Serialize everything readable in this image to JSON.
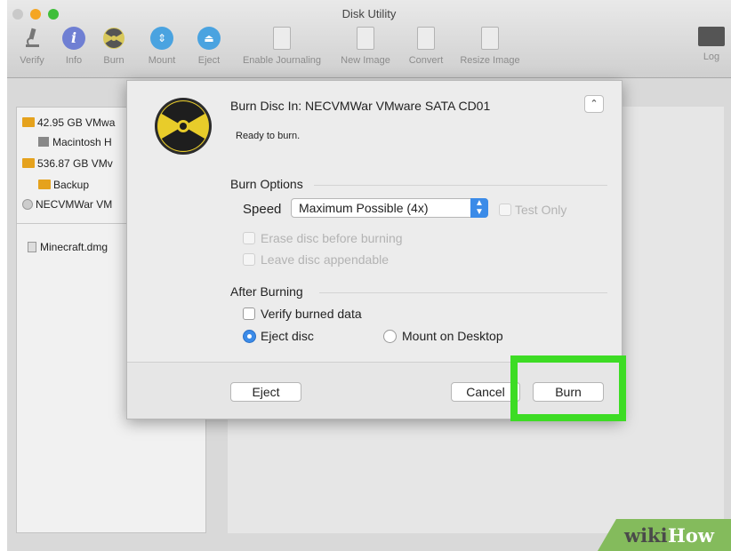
{
  "window": {
    "title": "Disk Utility"
  },
  "colors": {
    "highlight": "#3ddc24",
    "accent": "#3b8be8",
    "disk": "#e5a21d",
    "wikihow_green": "#84bb5c"
  },
  "toolbar": {
    "items": [
      {
        "label": "Verify",
        "icon": "microscope-icon"
      },
      {
        "label": "Info",
        "icon": "info-icon"
      },
      {
        "label": "Burn",
        "icon": "burn-icon"
      },
      {
        "label": "Mount",
        "icon": "mount-icon"
      },
      {
        "label": "Eject",
        "icon": "eject-icon"
      },
      {
        "label": "Enable Journaling",
        "icon": "journal-icon"
      },
      {
        "label": "New Image",
        "icon": "new-image-icon"
      },
      {
        "label": "Convert",
        "icon": "convert-icon"
      },
      {
        "label": "Resize Image",
        "icon": "resize-image-icon"
      },
      {
        "label": "Log",
        "icon": "log-icon"
      }
    ]
  },
  "sidebar": {
    "items": [
      {
        "label": "42.95 GB VMwa",
        "icon": "disk-icon"
      },
      {
        "label": "Macintosh H",
        "icon": "volume-icon"
      },
      {
        "label": "536.87 GB VMv",
        "icon": "disk-icon"
      },
      {
        "label": "Backup",
        "icon": "volume-icon"
      },
      {
        "label": "NECVMWar VM",
        "icon": "cd-icon"
      },
      {
        "label": "Minecraft.dmg",
        "icon": "dmg-icon"
      }
    ]
  },
  "dialog": {
    "title": "Burn Disc In:  NECVMWar VMware SATA CD01",
    "status": "Ready to burn.",
    "burn_options_heading": "Burn Options",
    "speed_label": "Speed",
    "speed_value": "Maximum Possible (4x)",
    "test_only_label": "Test Only",
    "erase_label": "Erase disc before burning",
    "appendable_label": "Leave disc appendable",
    "after_burning_heading": "After Burning",
    "verify_label": "Verify burned data",
    "eject_disc_label": "Eject disc",
    "mount_label": "Mount on Desktop",
    "eject_button": "Eject",
    "cancel_button": "Cancel",
    "burn_button": "Burn"
  },
  "watermark": {
    "part1": "wiki",
    "part2": "How"
  }
}
